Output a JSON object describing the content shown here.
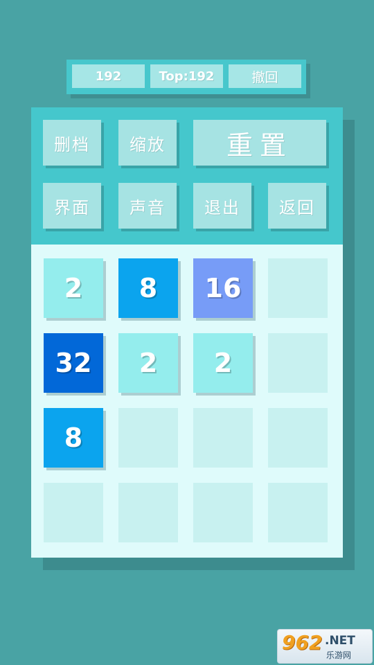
{
  "scorebar": {
    "score": "192",
    "top": "Top:192",
    "undo_label": "撤回"
  },
  "menu": {
    "delete_save": "删档",
    "zoom": "缩放",
    "reset": "重置",
    "interface": "界面",
    "sound": "声音",
    "exit": "退出",
    "back": "返回"
  },
  "board": {
    "size": 4,
    "grid": [
      [
        2,
        8,
        16,
        null
      ],
      [
        32,
        2,
        2,
        null
      ],
      [
        8,
        null,
        null,
        null
      ],
      [
        null,
        null,
        null,
        null
      ]
    ]
  },
  "colors": {
    "background": "#49a3a4",
    "menu_bg": "#45c7cc",
    "button_bg": "#a6e3e3",
    "board_bg": "#dffbfb",
    "empty_cell": "#c8f1f0",
    "tile_2": "#94eded",
    "tile_8": "#0ba4ee",
    "tile_16": "#779cf7",
    "tile_32": "#0268d8"
  },
  "watermark": {
    "brand_number": "962",
    "brand_suffix": ".NET",
    "brand_sub": "乐游网"
  }
}
